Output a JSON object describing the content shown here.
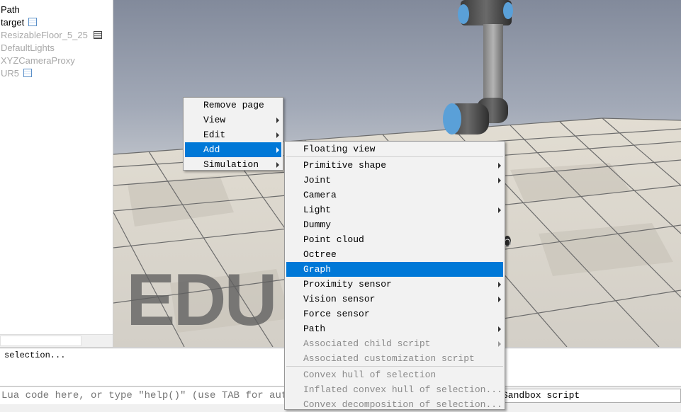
{
  "scene_hierarchy": {
    "items": [
      {
        "label": "Path",
        "icon": "",
        "dimmed": false
      },
      {
        "label": "target",
        "icon": "script-doc-icon",
        "dimmed": false
      },
      {
        "label": "ResizableFloor_5_25",
        "icon": "shape-icon",
        "dimmed": true
      },
      {
        "label": "DefaultLights",
        "icon": "",
        "dimmed": true
      },
      {
        "label": "XYZCameraProxy",
        "icon": "",
        "dimmed": true
      },
      {
        "label": "UR5",
        "icon": "script-doc-icon",
        "dimmed": true
      }
    ]
  },
  "viewport": {
    "watermark": "EDU"
  },
  "context_menu": {
    "items": [
      {
        "label": "Remove page",
        "submenu": false,
        "highlighted": false
      },
      {
        "label": "View",
        "submenu": true,
        "highlighted": false
      },
      {
        "label": "Edit",
        "submenu": true,
        "highlighted": false
      },
      {
        "label": "Add",
        "submenu": true,
        "highlighted": true
      },
      {
        "label": "Simulation",
        "submenu": true,
        "highlighted": false
      }
    ]
  },
  "add_submenu": {
    "items": [
      {
        "label": "Floating view",
        "submenu": false,
        "highlighted": false,
        "disabled": false
      },
      {
        "label": "Primitive shape",
        "submenu": true,
        "highlighted": false,
        "disabled": false
      },
      {
        "label": "Joint",
        "submenu": true,
        "highlighted": false,
        "disabled": false
      },
      {
        "label": "Camera",
        "submenu": false,
        "highlighted": false,
        "disabled": false
      },
      {
        "label": "Light",
        "submenu": true,
        "highlighted": false,
        "disabled": false
      },
      {
        "label": "Dummy",
        "submenu": false,
        "highlighted": false,
        "disabled": false
      },
      {
        "label": "Point cloud",
        "submenu": false,
        "highlighted": false,
        "disabled": false
      },
      {
        "label": "Octree",
        "submenu": false,
        "highlighted": false,
        "disabled": false
      },
      {
        "label": "Graph",
        "submenu": false,
        "highlighted": true,
        "disabled": false
      },
      {
        "label": "Proximity sensor",
        "submenu": true,
        "highlighted": false,
        "disabled": false
      },
      {
        "label": "Vision sensor",
        "submenu": true,
        "highlighted": false,
        "disabled": false
      },
      {
        "label": "Force sensor",
        "submenu": false,
        "highlighted": false,
        "disabled": false
      },
      {
        "label": "Path",
        "submenu": true,
        "highlighted": false,
        "disabled": false
      },
      {
        "label": "Associated child script",
        "submenu": true,
        "highlighted": false,
        "disabled": true
      },
      {
        "label": "Associated customization script",
        "submenu": false,
        "highlighted": false,
        "disabled": true
      },
      {
        "label": "Convex hull of selection",
        "submenu": false,
        "highlighted": false,
        "disabled": true
      },
      {
        "label": "Inflated convex hull of selection...",
        "submenu": false,
        "highlighted": false,
        "disabled": true
      },
      {
        "label": "Convex decomposition of selection...",
        "submenu": false,
        "highlighted": false,
        "disabled": true
      }
    ]
  },
  "console": {
    "status_text": "selection..."
  },
  "command_bar": {
    "lua_input_placeholder": "Lua code here, or type \"help()\" (use TAB for auto-completion)",
    "script_selector_value": "Sandbox script"
  },
  "colors": {
    "highlight": "#0078d7",
    "robot_accent": "#5aa0d8",
    "sky_top": "#828a9b"
  }
}
